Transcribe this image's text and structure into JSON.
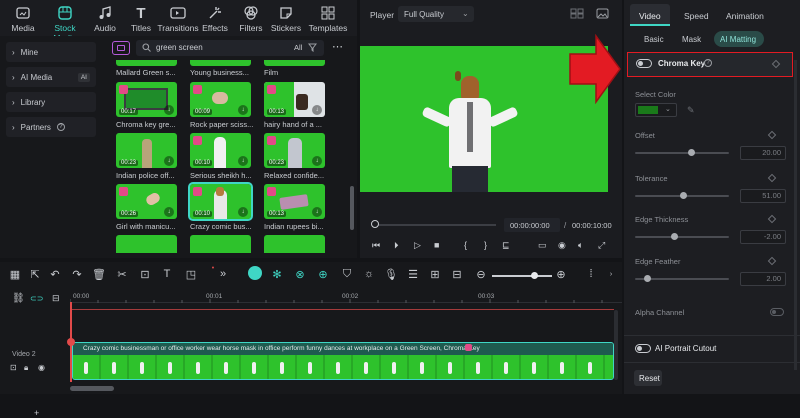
{
  "toolbar": {
    "items": [
      {
        "label": "Media",
        "icon": "media-icon"
      },
      {
        "label": "Stock Media",
        "icon": "stock-media-icon"
      },
      {
        "label": "Audio",
        "icon": "audio-icon"
      },
      {
        "label": "Titles",
        "icon": "titles-icon"
      },
      {
        "label": "Transitions",
        "icon": "transitions-icon"
      },
      {
        "label": "Effects",
        "icon": "effects-icon"
      },
      {
        "label": "Filters",
        "icon": "filters-icon"
      },
      {
        "label": "Stickers",
        "icon": "stickers-icon"
      },
      {
        "label": "Templates",
        "icon": "templates-icon"
      }
    ],
    "active": "Stock Media"
  },
  "sidebar": {
    "items": [
      {
        "label": "Mine"
      },
      {
        "label": "AI Media",
        "badge": "AI"
      },
      {
        "label": "Library"
      },
      {
        "label": "Partners"
      }
    ]
  },
  "media": {
    "search_placeholder": "green screen",
    "filter_label": "All",
    "top_labels": [
      "Mallard Green s...",
      "Young business...",
      "Film"
    ],
    "items": [
      {
        "label": "Chroma key gre...",
        "duration": "00:17"
      },
      {
        "label": "Rock paper sciss...",
        "duration": "00:09"
      },
      {
        "label": "hairy hand of a ...",
        "duration": "00:13"
      },
      {
        "label": "Indian police off...",
        "duration": "00:23"
      },
      {
        "label": "Serious sheikh h...",
        "duration": "00:10"
      },
      {
        "label": "Relaxed confide...",
        "duration": "00:23"
      },
      {
        "label": "Girl with manicu...",
        "duration": "00:26"
      },
      {
        "label": "Crazy comic bus...",
        "duration": "00:10"
      },
      {
        "label": "Indian rupees bi...",
        "duration": "00:13"
      }
    ]
  },
  "player": {
    "title": "Player",
    "quality": "Full Quality",
    "current_time": "00:00:00:00",
    "total_time": "00:00:10:00",
    "separator": "/"
  },
  "right_panel": {
    "tabs": [
      "Video",
      "Speed",
      "Animation"
    ],
    "active_tab": "Video",
    "subtabs": [
      "Basic",
      "Mask",
      "AI Matting"
    ],
    "active_subtab": "AI Matting",
    "chroma_key_label": "Chroma Key",
    "chroma_key_on": false,
    "select_color_label": "Select Color",
    "selected_color": "#1a7a1a",
    "sliders": [
      {
        "label": "Offset",
        "value": "20.00",
        "level": 0.6
      },
      {
        "label": "Tolerance",
        "value": "51.00",
        "level": 0.51
      },
      {
        "label": "Edge Thickness",
        "value": "-2.00",
        "level": 0.4
      },
      {
        "label": "Edge Feather",
        "value": "2.00",
        "level": 0.1
      }
    ],
    "alpha_channel_label": "Alpha Channel",
    "ai_portrait_label": "AI Portrait Cutout",
    "reset_label": "Reset"
  },
  "timeline": {
    "ruler": [
      "00:00",
      "00:01",
      "00:02",
      "00:03"
    ],
    "track_label": "Video 2",
    "clip_title": "Crazy comic businessman or office worker wear horse mask in office perform funny dances at workplace on a Green Screen, Chroma Key",
    "plus_label": "+"
  },
  "colors": {
    "accent": "#3fd6c5",
    "green_screen": "#2ec22c",
    "playhead": "#e24a4a",
    "arrow": "#e31b23"
  }
}
